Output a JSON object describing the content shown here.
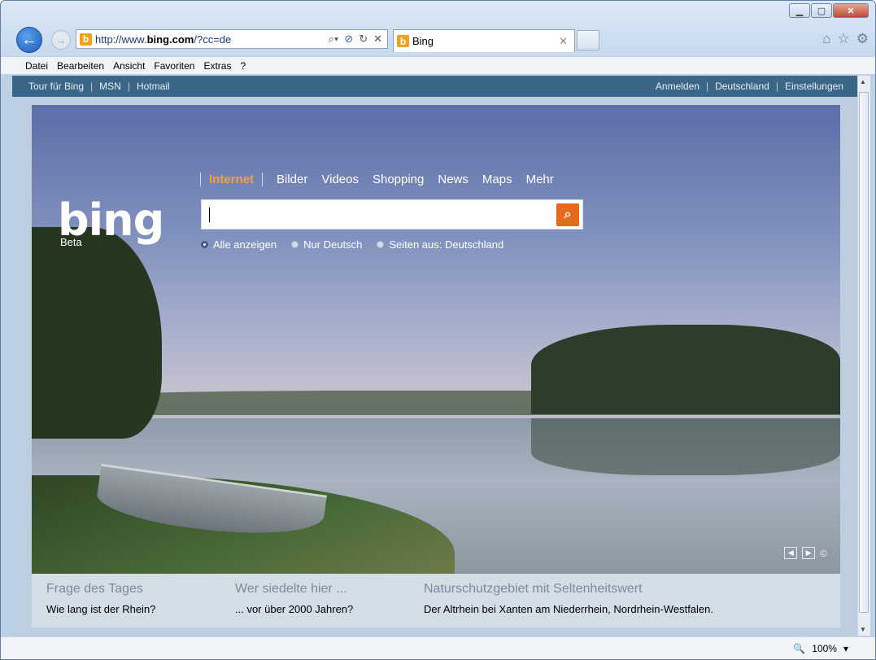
{
  "browser": {
    "url_prefix": "http://www.",
    "url_domain": "bing.com",
    "url_rest": "/?cc=de",
    "tab_title": "Bing",
    "zoom": "100%"
  },
  "menu": [
    "Datei",
    "Bearbeiten",
    "Ansicht",
    "Favoriten",
    "Extras",
    "?"
  ],
  "topnav": {
    "left": [
      "Tour für Bing",
      "MSN",
      "Hotmail"
    ],
    "right": [
      "Anmelden",
      "Deutschland",
      "Einstellungen"
    ]
  },
  "bing": {
    "logo": "bing",
    "beta": "Beta",
    "scopes": [
      "Internet",
      "Bilder",
      "Videos",
      "Shopping",
      "News",
      "Maps",
      "Mehr"
    ],
    "search_value": "",
    "radio_options": [
      "Alle anzeigen",
      "Nur Deutsch",
      "Seiten aus: Deutschland"
    ],
    "radio_selected": "Alle anzeigen"
  },
  "footer": [
    {
      "heading": "Frage des Tages",
      "text": "Wie lang ist der Rhein?"
    },
    {
      "heading": "Wer siedelte hier ...",
      "text": "... vor über 2000 Jahren?"
    },
    {
      "heading": "Naturschutzgebiet mit Seltenheitswert",
      "text": "Der Altrhein bei Xanten am Niederrhein, Nordrhein-Westfalen."
    }
  ],
  "icons": {
    "home": "home-icon",
    "favorites": "star-icon",
    "tools": "gear-icon"
  }
}
